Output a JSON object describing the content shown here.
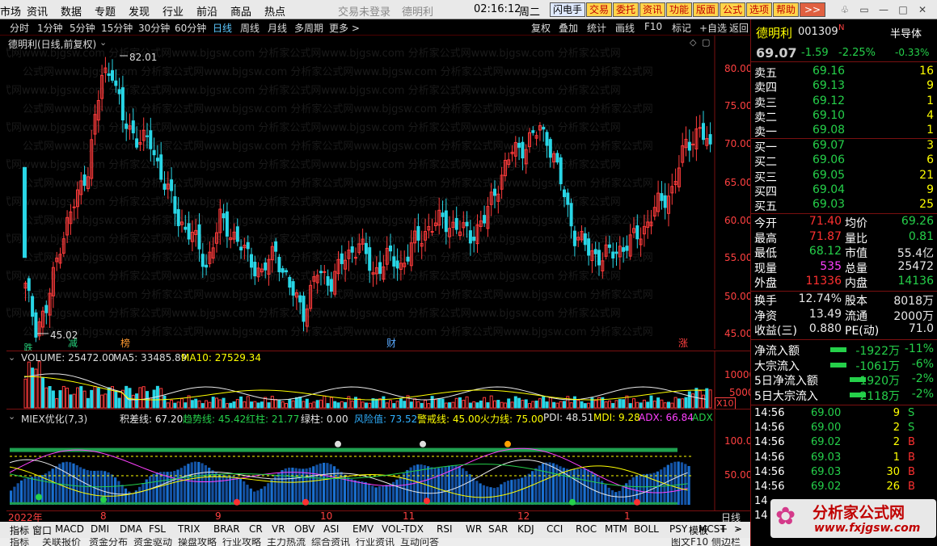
{
  "menubar": {
    "items": [
      "市场",
      "资讯",
      "数据",
      "专题",
      "发现",
      "行业",
      "前沿",
      "商品",
      "热点"
    ],
    "login_status": "交易未登录",
    "stock_name": "德明利",
    "time": "02:16:12",
    "weekday": "周二",
    "buttons": [
      "闪电手",
      "交易",
      "委托",
      "资讯",
      "功能",
      "版面",
      "公式",
      "选项",
      "帮助",
      ">>"
    ]
  },
  "tabbar": {
    "tabs": [
      "分时",
      "1分钟",
      "5分钟",
      "15分钟",
      "30分钟",
      "60分钟",
      "日线",
      "周线",
      "月线",
      "多周期",
      "更多 >"
    ],
    "active_tab": "日线",
    "right_tools": [
      "复权",
      "叠加",
      "统计",
      "画线",
      "F10",
      "标记",
      "+自选",
      "返回"
    ]
  },
  "main_chart": {
    "title": "德明利(日线,前复权)",
    "high_label": "82.01",
    "low_label": "45.02",
    "y_ticks": [
      "80.00",
      "75.00",
      "70.00",
      "65.00",
      "60.00",
      "55.00",
      "50.00",
      "45.00"
    ],
    "markers": [
      {
        "text": "跌",
        "color": "#26d07a"
      },
      {
        "text": "减",
        "color": "#26d07a"
      },
      {
        "text": "榜",
        "color": "#ff9a30"
      },
      {
        "text": "财",
        "color": "#5aaaff"
      },
      {
        "text": "涨",
        "color": "#ff4040"
      }
    ]
  },
  "volume": {
    "label": "VOLUME: 25472.00",
    "ma5": "MA5: 33485.89",
    "ma10": "MA10: 27529.34",
    "y_ticks": [
      "10000",
      "5000"
    ],
    "unit": "X10"
  },
  "indicator": {
    "name": "MIEX优化(7,3)",
    "items": [
      {
        "label": "积差线: 67.20",
        "color": "#e8e8e8"
      },
      {
        "label": "趋势线: 45.42",
        "color": "#25d04a"
      },
      {
        "label": "红柱: 21.77",
        "color": "#25d04a"
      },
      {
        "label": "绿柱: 0.00",
        "color": "#e8e8e8"
      },
      {
        "label": "风险值: 73.52",
        "color": "#30b0ff"
      },
      {
        "label": "警戒线: 45.00",
        "color": "#ffff00"
      },
      {
        "label": "火力线: 75.00",
        "color": "#ffff00"
      },
      {
        "label": "PDI: 48.51",
        "color": "#e8e8e8"
      },
      {
        "label": "MDI: 9.28",
        "color": "#ffff00"
      },
      {
        "label": "ADX: 66.84",
        "color": "#ff40ff"
      },
      {
        "label": "ADX",
        "color": "#25d04a"
      }
    ],
    "y_ticks": [
      "100.0",
      "50.00"
    ]
  },
  "date_axis": {
    "labels": [
      "2022年",
      "8",
      "9",
      "10",
      "11",
      "12",
      "1"
    ],
    "period": "日线"
  },
  "bottom_toolbar": {
    "items": [
      "指标",
      "窗口",
      "MACD",
      "DMI",
      "DMA",
      "FSL",
      "TRIX",
      "BRAR",
      "CR",
      "VR",
      "OBV",
      "ASI",
      "EMV",
      "VOL-TDX",
      "RSI",
      "WR",
      "SAR",
      "KDJ",
      "CCI",
      "ROC",
      "MTM",
      "BOLL",
      "PSY",
      "MCST",
      ">",
      "模板",
      "+",
      "-"
    ],
    "second_row": [
      "指标",
      "关联报价",
      "资金分布",
      "资金驱动",
      "操盘攻略",
      "行业攻略",
      "主力热流",
      "综合资讯",
      "行业资讯",
      "互动问答",
      "图文F10",
      "侧边栏"
    ]
  },
  "right_panel": {
    "name": "德明利",
    "code": "001309",
    "flag": "N",
    "sector": "半导体",
    "sector_change": "-0.33%",
    "price": "69.07",
    "change": "-1.59",
    "change_pct": "-2.25%",
    "asks": [
      {
        "label": "卖五",
        "price": "69.16",
        "vol": "16"
      },
      {
        "label": "卖四",
        "price": "69.13",
        "vol": "9"
      },
      {
        "label": "卖三",
        "price": "69.12",
        "vol": "1"
      },
      {
        "label": "卖二",
        "price": "69.10",
        "vol": "4"
      },
      {
        "label": "卖一",
        "price": "69.08",
        "vol": "1"
      }
    ],
    "bids": [
      {
        "label": "买一",
        "price": "69.07",
        "vol": "3"
      },
      {
        "label": "买二",
        "price": "69.06",
        "vol": "6"
      },
      {
        "label": "买三",
        "price": "69.05",
        "vol": "21"
      },
      {
        "label": "买四",
        "price": "69.04",
        "vol": "9"
      },
      {
        "label": "买五",
        "price": "69.03",
        "vol": "25"
      }
    ],
    "stats": [
      {
        "l1": "今开",
        "v1": "71.40",
        "c1": "red",
        "l2": "均价",
        "v2": "69.26",
        "c2": "green"
      },
      {
        "l1": "最高",
        "v1": "71.87",
        "c1": "red",
        "l2": "量比",
        "v2": "0.81",
        "c2": "green"
      },
      {
        "l1": "最低",
        "v1": "68.12",
        "c1": "green",
        "l2": "市值",
        "v2": "55.4亿",
        "c2": "white"
      },
      {
        "l1": "现量",
        "v1": "535",
        "c1": "magenta",
        "l2": "总量",
        "v2": "25472",
        "c2": "white"
      },
      {
        "l1": "外盘",
        "v1": "11336",
        "c1": "red",
        "l2": "内盘",
        "v2": "14136",
        "c2": "green"
      }
    ],
    "stats2": [
      {
        "l1": "换手",
        "v1": "12.74%",
        "l2": "股本",
        "v2": "8018万"
      },
      {
        "l1": "净资",
        "v1": "13.49",
        "l2": "流通",
        "v2": "2000万"
      },
      {
        "l1": "收益(三)",
        "v1": "0.880",
        "l2": "PE(动)",
        "v2": "71.0"
      }
    ],
    "flows": [
      {
        "label": "净流入额",
        "value": "-1922万",
        "pct": "-11%"
      },
      {
        "label": "大宗流入",
        "value": "-1061万",
        "pct": "-6%"
      },
      {
        "label": "5日净流入额",
        "value": "-1920万",
        "pct": "-2%"
      },
      {
        "label": "5日大宗流入",
        "value": "-2118万",
        "pct": "-2%"
      }
    ],
    "ticks": [
      {
        "time": "14:56",
        "price": "69.00",
        "vol": "9",
        "side": "S"
      },
      {
        "time": "14:56",
        "price": "69.00",
        "vol": "2",
        "side": "S"
      },
      {
        "time": "14:56",
        "price": "69.02",
        "vol": "2",
        "side": "B"
      },
      {
        "time": "14:56",
        "price": "69.03",
        "vol": "1",
        "side": "B"
      },
      {
        "time": "14:56",
        "price": "69.03",
        "vol": "30",
        "side": "B"
      },
      {
        "time": "14:56",
        "price": "69.02",
        "vol": "26",
        "side": "B"
      },
      {
        "time": "14",
        "price": "",
        "vol": "",
        "side": ""
      },
      {
        "time": "14",
        "price": "",
        "vol": "",
        "side": ""
      }
    ]
  },
  "watermark": {
    "brand": "分析家公式网",
    "url": "www.fxjgsw.com"
  }
}
